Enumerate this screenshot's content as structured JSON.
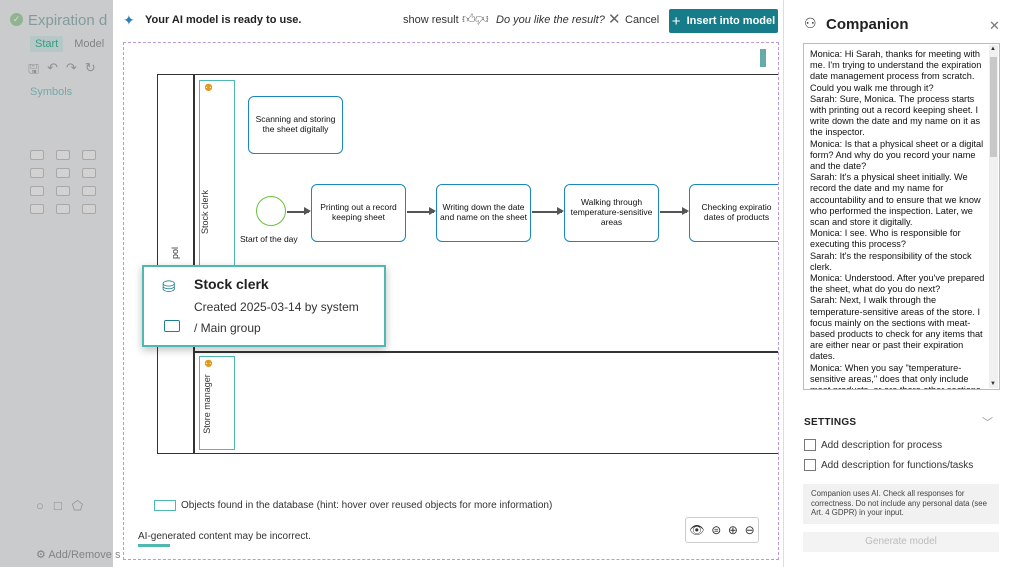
{
  "editor": {
    "title": "Expiration d",
    "tabs": [
      "Start",
      "Model"
    ],
    "symbols_label": "Symbols",
    "add_remove_label": "Add/Remove s"
  },
  "topbar": {
    "ai_ready": "Your AI model is ready to use.",
    "show_result": "show result",
    "like_question": "Do you like the result?",
    "cancel": "Cancel",
    "insert": "Insert into model"
  },
  "diagram": {
    "pool_label": "pol",
    "lanes": [
      "Stock clerk",
      "Store manager"
    ],
    "start_event": "Start of the day",
    "tasks": [
      "Scanning and storing the sheet digitally",
      "Printing out a record keeping sheet",
      "Writing down the date and name on the sheet",
      "Walking through temperature-sensitive areas",
      "Checking expiratio dates of products"
    ]
  },
  "tooltip": {
    "name": "Stock clerk",
    "created": "Created 2025-03-14 by system",
    "group": "/ Main group"
  },
  "canvas_footer": {
    "legend": "Objects found in the database (hint: hover over reused objects for more information)",
    "disclaimer": "AI-generated content may be incorrect."
  },
  "companion": {
    "title": "Companion",
    "transcript": "Monica: Hi Sarah, thanks for meeting with me. I'm trying to understand the expiration date management process from scratch. Could you walk me through it?\nSarah: Sure, Monica. The process starts with printing out a record keeping sheet. I write down the date and my name on it as the inspector.\nMonica:  Is that a physical sheet or a digital form? And why do you record your name and the date?\nSarah: It's a physical sheet initially. We record the date and my name for accountability and to ensure that we know who performed the inspection. Later, we scan and store it digitally.\nMonica: I see. Who is responsible for executing this process?\nSarah: It's the responsibility of the stock clerk.\nMonica: Understood. After you've prepared the sheet, what do you do next?\nSarah: Next, I walk through the temperature-sensitive areas of the store. I focus mainly on the sections with meat-based products to check for any items that are either near or past their expiration dates.\nMonica: When you say \"temperature-sensitive areas,\" does that only include meat products, or are there other sections",
    "settings_label": "SETTINGS",
    "options": [
      "Add description for process",
      "Add description for functions/tasks"
    ],
    "ai_note": "Companion uses AI. Check all responses for correctness. Do not include any personal data (see Art. 4 GDPR) in your input.",
    "generate_button": "Generate model"
  }
}
